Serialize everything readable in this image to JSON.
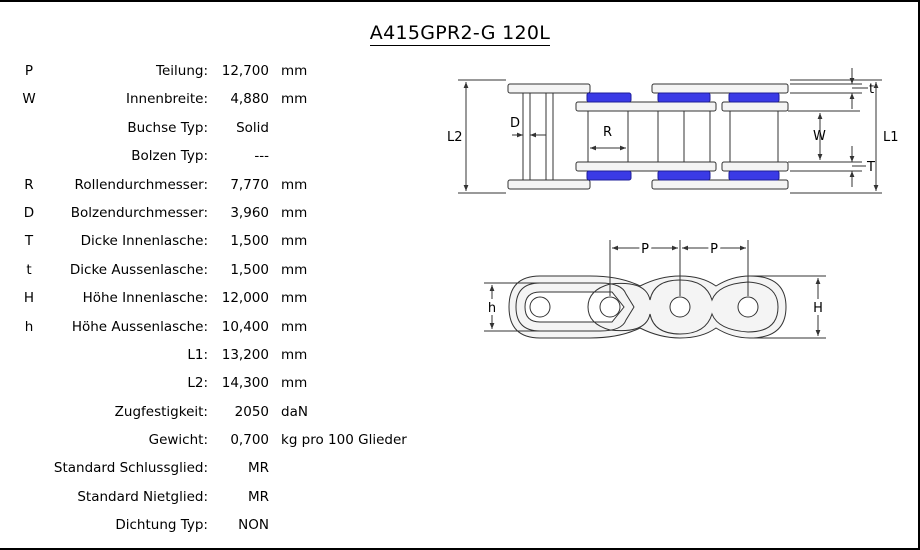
{
  "title": "A415GPR2-G 120L",
  "specs": [
    {
      "symbol": "P",
      "label": "Teilung:",
      "value": "12,700",
      "unit": "mm"
    },
    {
      "symbol": "W",
      "label": "Innenbreite:",
      "value": "4,880",
      "unit": "mm"
    },
    {
      "symbol": "",
      "label": "Buchse Typ:",
      "value": "Solid",
      "unit": ""
    },
    {
      "symbol": "",
      "label": "Bolzen Typ:",
      "value": "---",
      "unit": ""
    },
    {
      "symbol": "R",
      "label": "Rollendurchmesser:",
      "value": "7,770",
      "unit": "mm"
    },
    {
      "symbol": "D",
      "label": "Bolzendurchmesser:",
      "value": "3,960",
      "unit": "mm"
    },
    {
      "symbol": "T",
      "label": "Dicke Innenlasche:",
      "value": "1,500",
      "unit": "mm"
    },
    {
      "symbol": "t",
      "label": "Dicke Aussenlasche:",
      "value": "1,500",
      "unit": "mm"
    },
    {
      "symbol": "H",
      "label": "Höhe Innenlasche:",
      "value": "12,000",
      "unit": "mm"
    },
    {
      "symbol": "h",
      "label": "Höhe Aussenlasche:",
      "value": "10,400",
      "unit": "mm"
    },
    {
      "symbol": "",
      "label": "L1:",
      "value": "13,200",
      "unit": "mm"
    },
    {
      "symbol": "",
      "label": "L2:",
      "value": "14,300",
      "unit": "mm"
    },
    {
      "symbol": "",
      "label": "Zugfestigkeit:",
      "value": "2050",
      "unit": "daN"
    },
    {
      "symbol": "",
      "label": "Gewicht:",
      "value": "0,700",
      "unit": "kg pro 100 Glieder"
    },
    {
      "symbol": "",
      "label": "Standard Schlussglied:",
      "value": "MR",
      "unit": ""
    },
    {
      "symbol": "",
      "label": "Standard Nietglied:",
      "value": "MR",
      "unit": ""
    },
    {
      "symbol": "",
      "label": "Dichtung Typ:",
      "value": "NON",
      "unit": ""
    }
  ],
  "diagram": {
    "top_view": {
      "label_L2": "L2",
      "label_L1": "L1",
      "label_D": "D",
      "label_R": "R",
      "label_W": "W",
      "label_t": "t",
      "label_T": "T"
    },
    "side_view": {
      "label_P1": "P",
      "label_P2": "P",
      "label_h": "h",
      "label_H": "H"
    },
    "colors": {
      "seal": "#3a3ae6",
      "line": "#333333",
      "plate_fill": "#f4f4f4"
    }
  }
}
